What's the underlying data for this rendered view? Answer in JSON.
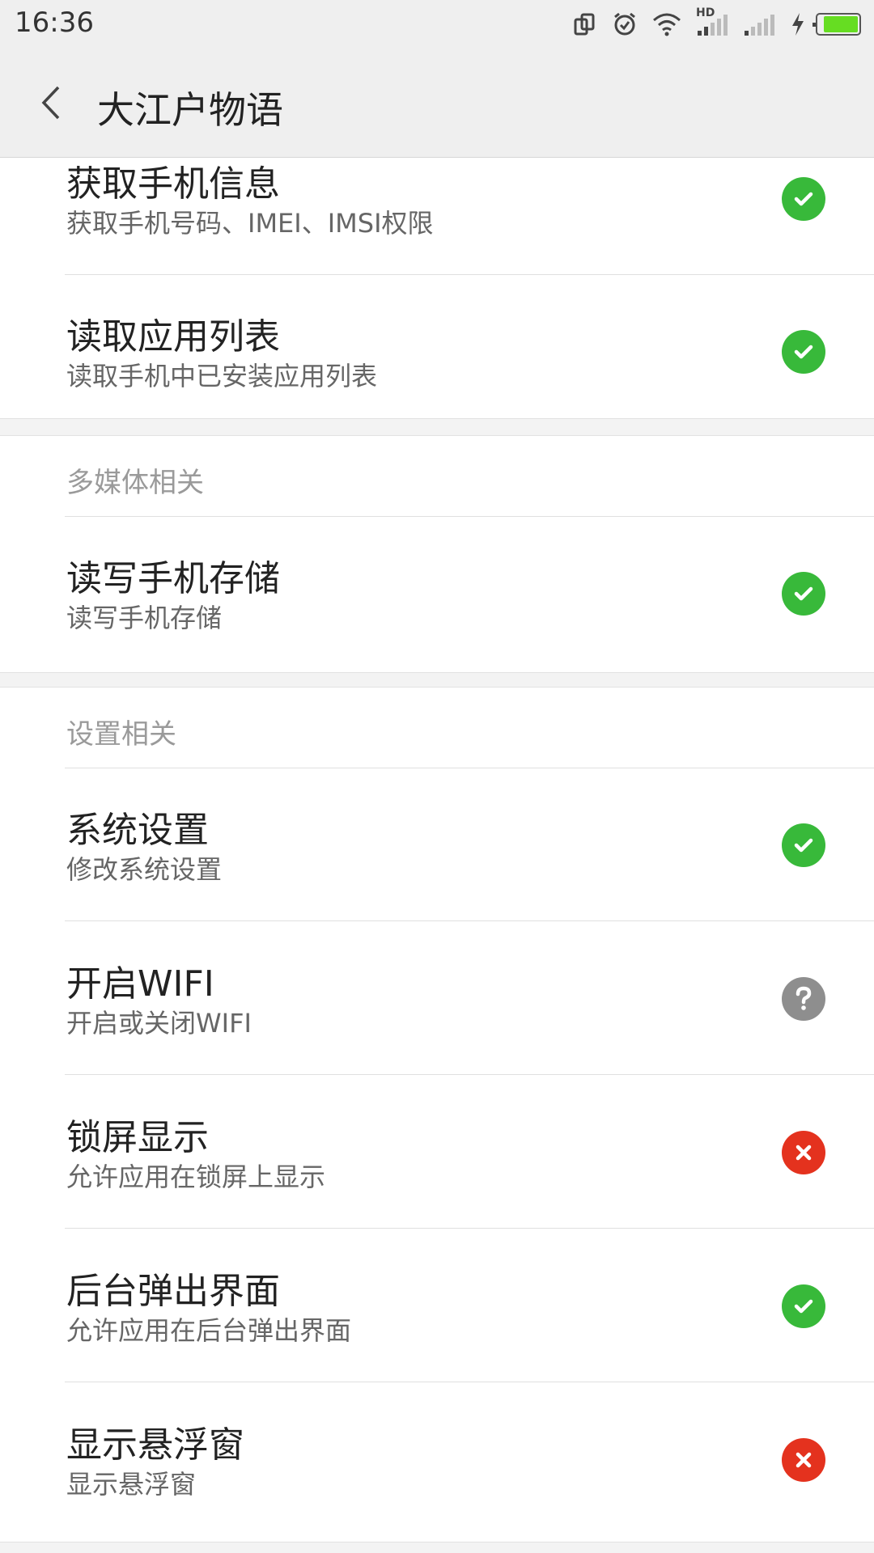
{
  "status_bar": {
    "time": "16:36",
    "network_label": "HD",
    "icons": [
      "screen-rotate-icon",
      "alarm-icon",
      "wifi-icon",
      "signal-hd-icon",
      "signal-icon",
      "charging-icon",
      "battery-icon"
    ],
    "battery_color": "#66dd22"
  },
  "app_bar": {
    "title": "大江户物语",
    "back_icon": "chevron-left-icon"
  },
  "sections": [
    {
      "items": [
        {
          "title": "获取手机信息",
          "subtitle": "获取手机号码、IMEI、IMSI权限",
          "status": "allowed"
        },
        {
          "title": "读取应用列表",
          "subtitle": "读取手机中已安装应用列表",
          "status": "allowed"
        }
      ]
    },
    {
      "header": "多媒体相关",
      "items": [
        {
          "title": "读写手机存储",
          "subtitle": "读写手机存储",
          "status": "allowed"
        }
      ]
    },
    {
      "header": "设置相关",
      "items": [
        {
          "title": "系统设置",
          "subtitle": "修改系统设置",
          "status": "allowed"
        },
        {
          "title": "开启WIFI",
          "subtitle": "开启或关闭WIFI",
          "status": "ask"
        },
        {
          "title": "锁屏显示",
          "subtitle": "允许应用在锁屏上显示",
          "status": "denied"
        },
        {
          "title": "后台弹出界面",
          "subtitle": "允许应用在后台弹出界面",
          "status": "allowed"
        },
        {
          "title": "显示悬浮窗",
          "subtitle": "显示悬浮窗",
          "status": "denied"
        }
      ]
    }
  ],
  "colors": {
    "allowed": "#38b93a",
    "denied": "#e4321e",
    "ask": "#8e8e8e"
  }
}
